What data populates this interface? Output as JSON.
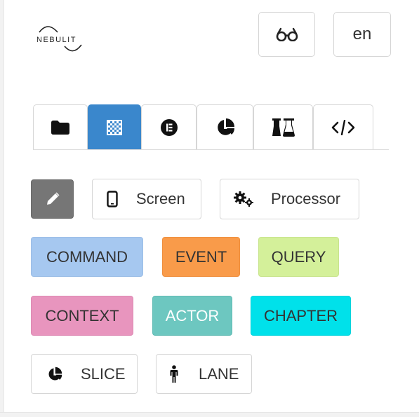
{
  "header": {
    "logo_text": "NEBULIT",
    "view_toggle_icon": "glasses-icon",
    "language": "en"
  },
  "tabs": [
    {
      "icon": "folder-icon",
      "active": false
    },
    {
      "icon": "checkerboard-icon",
      "active": true
    },
    {
      "icon": "list-circle-icon",
      "active": false
    },
    {
      "icon": "pie-chart-icon",
      "active": false
    },
    {
      "icon": "flasks-icon",
      "active": false
    },
    {
      "icon": "code-icon",
      "active": false
    }
  ],
  "tools": {
    "pen_icon": "pencil-icon",
    "screen_label": "Screen",
    "processor_label": "Processor"
  },
  "elements": {
    "command": "COMMAND",
    "event": "EVENT",
    "query": "QUERY",
    "context": "CONTEXT",
    "actor": "ACTOR",
    "chapter": "CHAPTER",
    "slice": "SLICE",
    "lane": "LANE"
  },
  "colors": {
    "active_tab": "#3a87cc",
    "command": "#a6c8f0",
    "event": "#f99b4a",
    "query": "#d4f09a",
    "context": "#e895be",
    "actor": "#6dc7c0",
    "chapter": "#00e1ea",
    "pen_button": "#767676"
  }
}
